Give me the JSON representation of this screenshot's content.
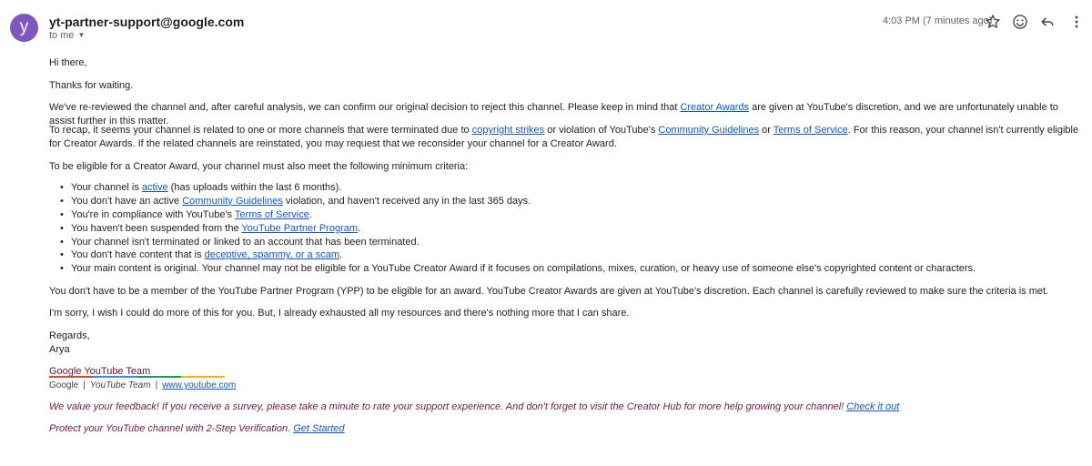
{
  "header": {
    "avatar_letter": "y",
    "sender": "yt-partner-support@google.com",
    "to": "to me",
    "time": "4:03 PM (7 minutes ago)",
    "icons": [
      "star-icon",
      "emoji-icon",
      "reply-icon",
      "more-vert-icon"
    ],
    "avatar_color": "#7e57c2"
  },
  "body": {
    "greeting": "Hi there,",
    "thanks": "Thanks for waiting.",
    "p3_a": "We've re-reviewed the channel and, after careful analysis, we can confirm our original decision to reject this channel. Please keep in mind that ",
    "p3_link": "Creator Awards",
    "p3_b": " are given at YouTube's discretion, and we are unfortunately unable to assist further in this matter.",
    "p4_a": "To recap, it seems your channel is related to one or more channels that were terminated due to ",
    "p4_link1": "copyright strikes",
    "p4_b": " or violation of YouTube's ",
    "p4_link2": "Community Guidelines",
    "p4_c": " or ",
    "p4_link3": "Terms of Service",
    "p4_d": ". For this reason, your channel isn't currently eligible for Creator Awards. If the related channels are reinstated, you may request that we reconsider your channel for a Creator Award.",
    "p5": "To be eligible for a Creator Award, your channel must also meet the following minimum criteria:",
    "criteria": {
      "c1_a": "Your channel is ",
      "c1_link": "active",
      "c1_b": " (has uploads within the last 6 months).",
      "c2_a": "You don't have an active ",
      "c2_link": "Community Guidelines",
      "c2_b": " violation, and haven't received any in the last 365 days.",
      "c3_a": "You're in compliance with YouTube's ",
      "c3_link": "Terms of Service",
      "c3_b": ".",
      "c4_a": "You haven't been suspended from the ",
      "c4_link": "YouTube Partner Program",
      "c4_b": ".",
      "c5": "Your channel isn't terminated or linked to an account that has been terminated.",
      "c6_a": "You don't have content that is ",
      "c6_link": "deceptive, spammy, or a scam",
      "c6_b": ".",
      "c7": "Your main content is original. Your channel may not be eligible for a YouTube Creator Award if it focuses on compilations, mixes, curation, or heavy use of someone else's copyrighted content or characters."
    },
    "p6": "You don't have to be a member of the YouTube Partner Program (YPP) to be eligible for an award. YouTube Creator Awards are given at YouTube's discretion. Each channel is carefully reviewed to make sure the criteria is met.",
    "p7": "I'm sorry, I wish I could do more of this for you. But, I already exhausted all my resources and there's nothing more that I can share.",
    "regards": "Regards,",
    "name": "Arya"
  },
  "signature": {
    "team": "Google YouTube Team",
    "google": "Google",
    "sep1": "|",
    "yt_team": "YouTube Team",
    "sep2": "|",
    "site": "www.youtube.com"
  },
  "footer": {
    "feedback": "We value your feedback! If you receive a survey, please take a minute to rate your support experience. And don't forget to visit the Creator Hub for more help growing your channel! ",
    "feedback_link": "Check it out",
    "protect": "Protect your YouTube channel with 2-Step Verification. ",
    "protect_link": "Get Started"
  }
}
